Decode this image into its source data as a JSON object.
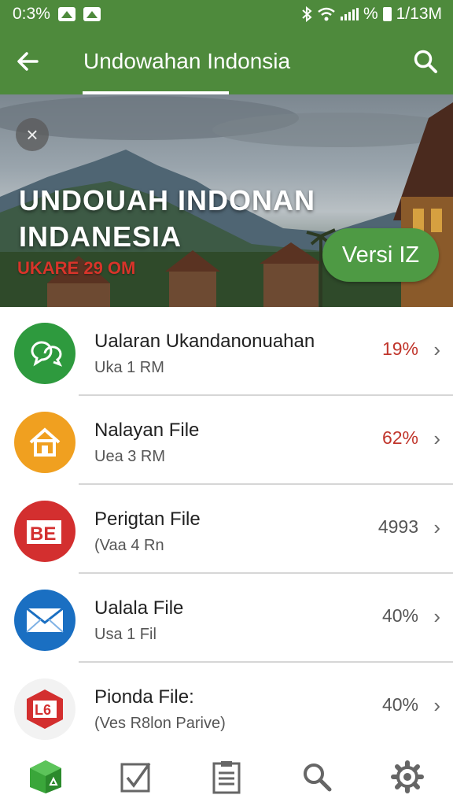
{
  "status_bar": {
    "left_text": "0:3%",
    "right_text": "% ",
    "time": "1/13M"
  },
  "app_bar": {
    "title": "Undowahan Indonsia"
  },
  "hero": {
    "headline_line1": "UNDOUAH  INDONAN",
    "headline_line2": "INDANESIA",
    "promo": "UKARE 29 OM",
    "version_button": "Versi IZ"
  },
  "items": [
    {
      "name": "Ualaran Ukandanonuahan",
      "sub": "Uka 1 RM",
      "value": "19%",
      "value_color": "#c0352b",
      "icon": "chat-bubbles-icon",
      "icon_color": "#2e9a3e"
    },
    {
      "name": "Nalayan File",
      "sub": "Uea 3 RM",
      "value": "62%",
      "value_color": "#c0352b",
      "icon": "house-icon",
      "icon_color": "#f0a020"
    },
    {
      "name": "Perigtan File",
      "sub": "(Vaa 4 Rn",
      "value": "4993",
      "value_color": "#555555",
      "icon": "be-document-icon",
      "icon_color": "#d32f2f"
    },
    {
      "name": "Ualala File",
      "sub": "Usa 1 Fil",
      "value": "40%",
      "value_color": "#555555",
      "icon": "mail-envelope-icon",
      "icon_color": "#1a6fc2"
    },
    {
      "name": "Pionda File:",
      "sub": "(Ves R8lon Parive)",
      "value": "40%",
      "value_color": "#555555",
      "icon": "l6-hexagon-icon",
      "icon_color": "#e53935"
    }
  ],
  "bottom_nav": [
    "app-home-icon",
    "checkbox-icon",
    "clipboard-icon",
    "search-icon",
    "settings-gear-icon"
  ]
}
